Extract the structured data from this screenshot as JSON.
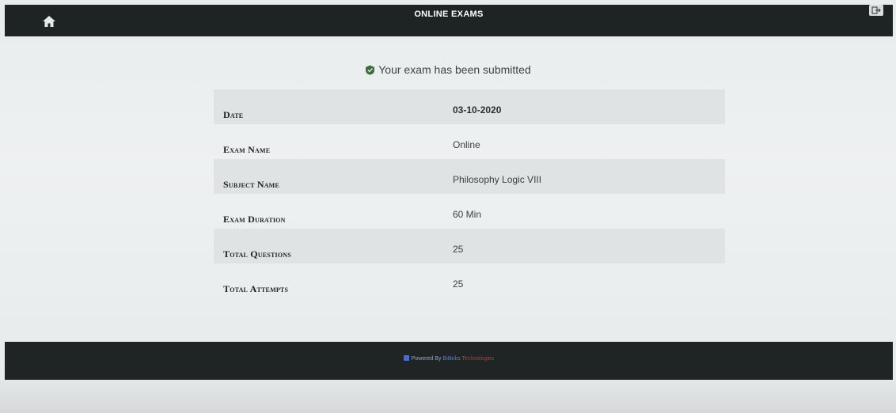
{
  "header": {
    "title": "ONLINE EXAMS",
    "home_icon": "home-icon",
    "logout_icon": "logout-icon"
  },
  "status": {
    "message": "Your exam has been submitted",
    "icon": "check-shield-icon",
    "icon_color": "#3e6b3e"
  },
  "exam_info": {
    "rows": [
      {
        "label": "Date",
        "value": "03-10-2020"
      },
      {
        "label": "Exam Name",
        "value": "Online"
      },
      {
        "label": "Subject Name",
        "value": "Philosophy Logic VIII"
      },
      {
        "label": "Exam Duration",
        "value": "60 Min"
      },
      {
        "label": "Total Questions",
        "value": "25"
      },
      {
        "label": "Total Attempts",
        "value": "25"
      }
    ]
  },
  "footer": {
    "powered_by": "Powered By",
    "brand_part1": "Bitlinks",
    "brand_part2": "Technologies"
  },
  "colors": {
    "header_bg": "#1e2323",
    "footer_bg": "#1f2424",
    "stripe": "#dfe3e3"
  }
}
